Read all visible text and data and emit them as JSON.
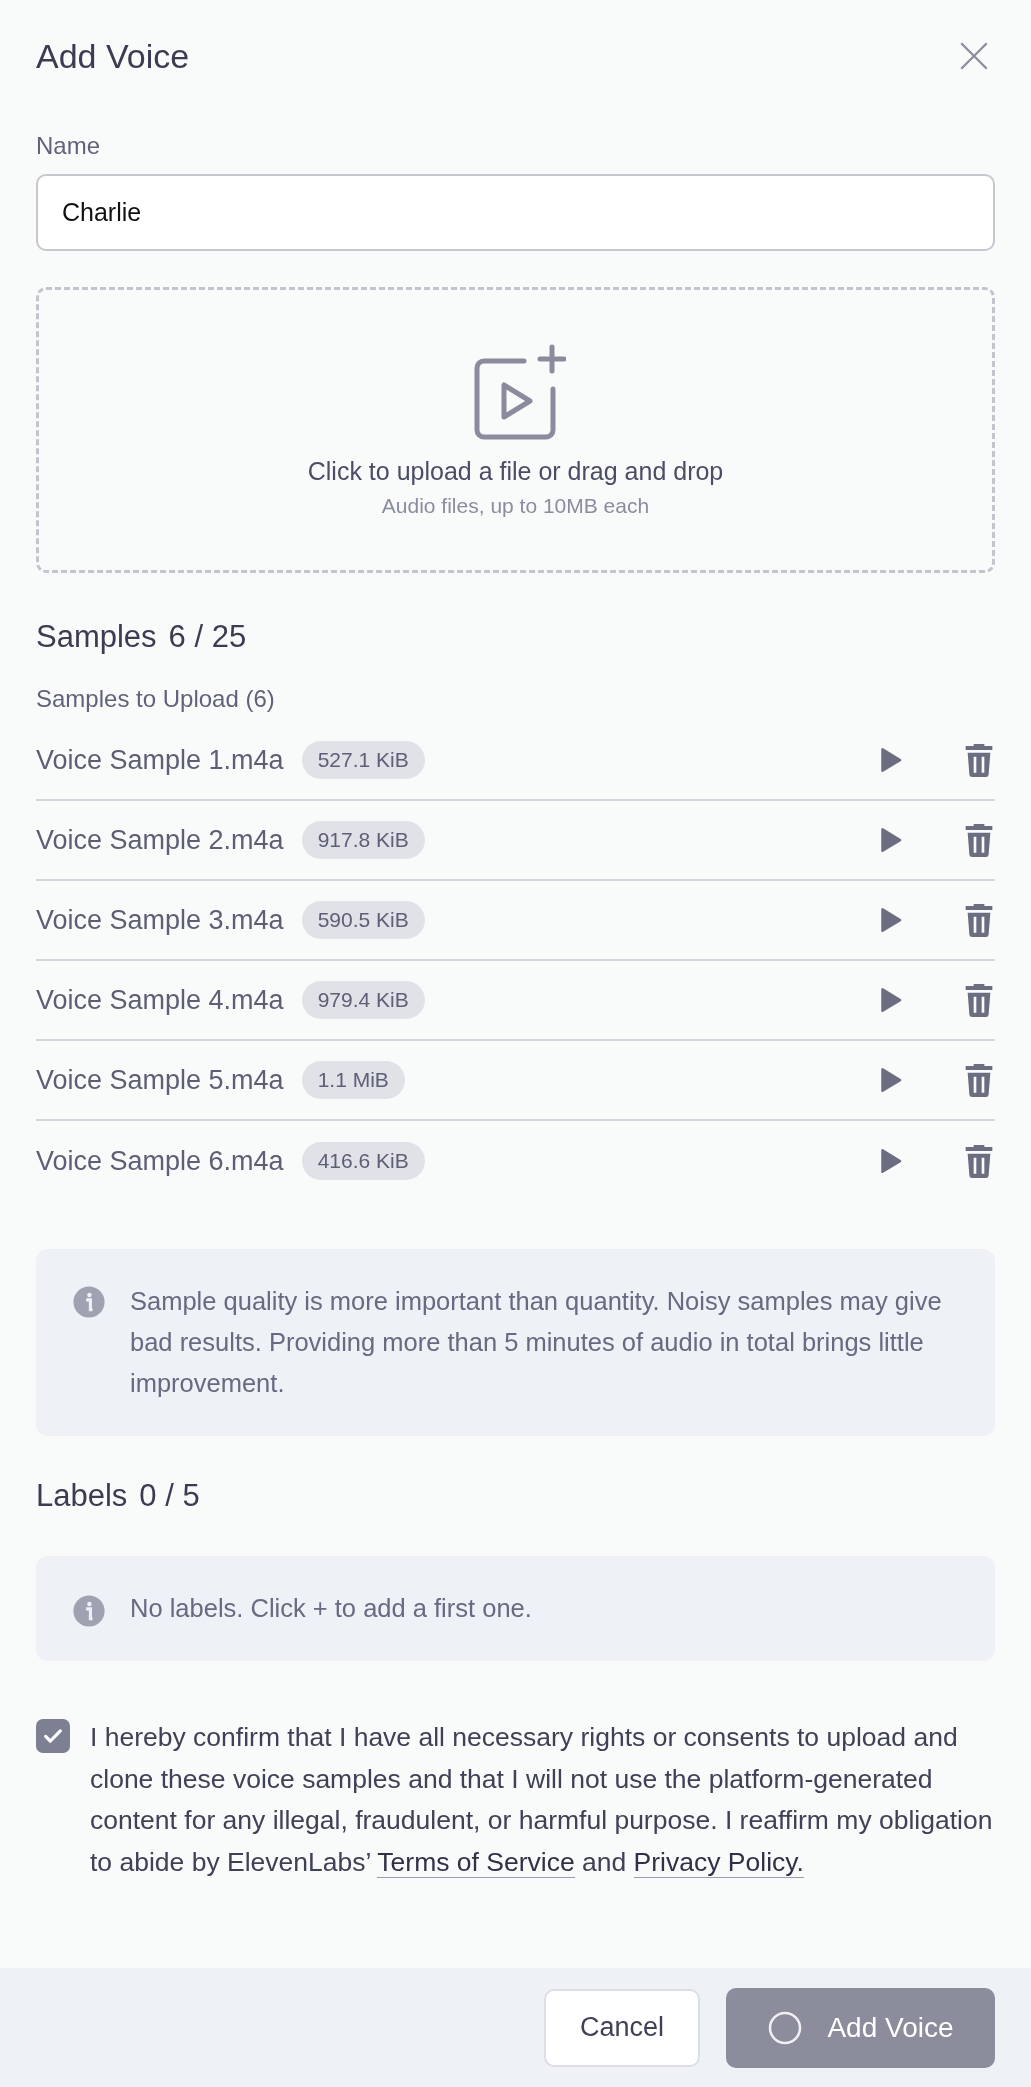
{
  "dialog": {
    "title": "Add Voice"
  },
  "name_field": {
    "label": "Name",
    "value": "Charlie"
  },
  "upload": {
    "prompt": "Click to upload a file or drag and drop",
    "hint": "Audio files, up to 10MB each"
  },
  "samples": {
    "title": "Samples",
    "count": "6 / 25",
    "subtitle": "Samples to Upload (6)",
    "items": [
      {
        "name": "Voice Sample 1.m4a",
        "size": "527.1 KiB"
      },
      {
        "name": "Voice Sample 2.m4a",
        "size": "917.8 KiB"
      },
      {
        "name": "Voice Sample 3.m4a",
        "size": "590.5 KiB"
      },
      {
        "name": "Voice Sample 4.m4a",
        "size": "979.4 KiB"
      },
      {
        "name": "Voice Sample 5.m4a",
        "size": "1.1 MiB"
      },
      {
        "name": "Voice Sample 6.m4a",
        "size": "416.6 KiB"
      }
    ]
  },
  "notice": "Sample quality is more important than quantity. Noisy samples may give bad results. Providing more than 5 minutes of audio in total brings little improvement.",
  "labels": {
    "title": "Labels",
    "count": "0 / 5",
    "empty_text": "No labels. Click + to add a first one."
  },
  "consent": {
    "checked": true,
    "text": "I hereby confirm that I have all necessary rights or consents to upload and clone these voice samples and that I will not use the platform-generated content for any illegal, fraudulent, or harmful purpose. I reaffirm my obligation to abide by ElevenLabs’",
    "terms_link": "Terms of Service",
    "joiner": "and",
    "privacy_link": "Privacy Policy."
  },
  "footer": {
    "cancel": "Cancel",
    "submit": "Add Voice",
    "submit_loading": true
  }
}
